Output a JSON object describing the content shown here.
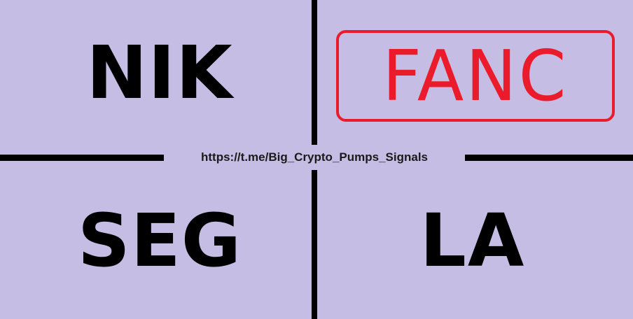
{
  "background_color": "#c6bde5",
  "divider_color": "#000000",
  "stamp_color": "#ea1c2c",
  "quadrants": {
    "top_left": {
      "text": "NIK"
    },
    "top_right": {
      "text": "FANC"
    },
    "bottom_left": {
      "text": "SEG"
    },
    "bottom_right": {
      "text": "LA"
    }
  },
  "center_link": "https://t.me/Big_Crypto_Pumps_Signals"
}
